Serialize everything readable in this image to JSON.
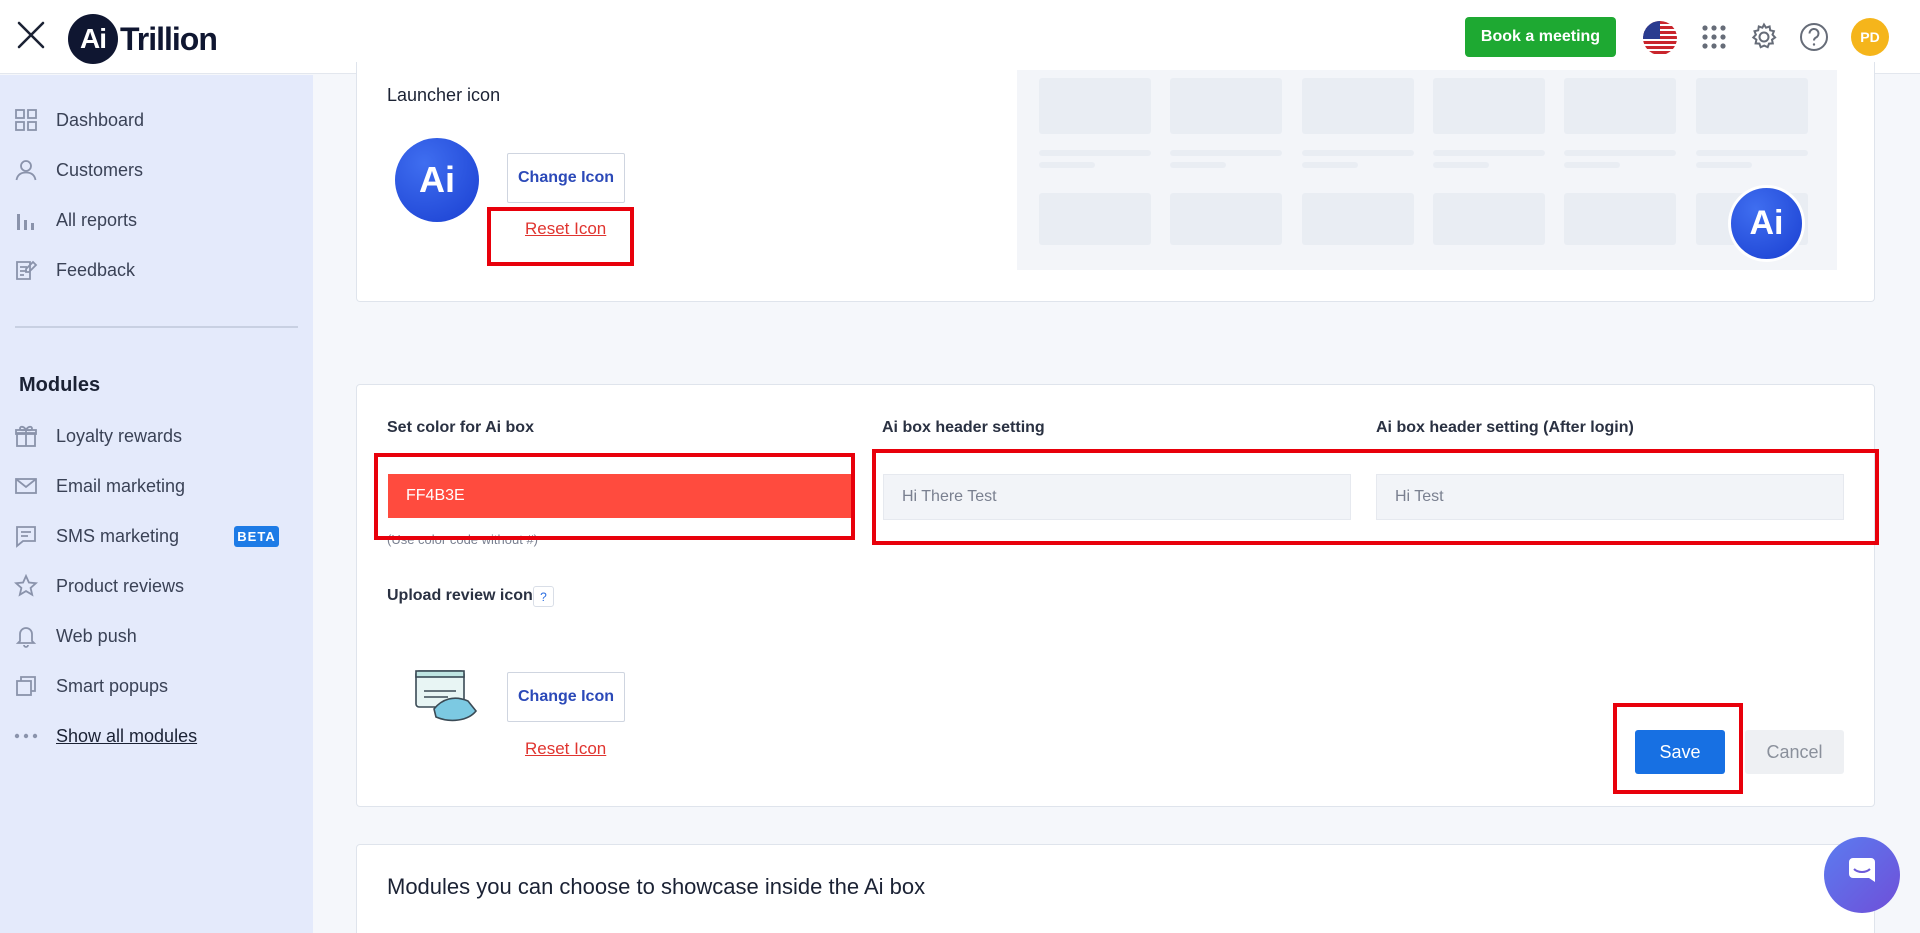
{
  "app": {
    "logo_mark": "Ai",
    "logo_text": "Trillion"
  },
  "header": {
    "book_meeting_label": "Book a meeting",
    "avatar_initials": "PD",
    "icons": [
      "close-icon",
      "us-flag-icon",
      "apps-grid-icon",
      "gear-icon",
      "help-icon"
    ]
  },
  "sidebar": {
    "items": [
      {
        "label": "Dashboard",
        "icon": "dashboard-icon"
      },
      {
        "label": "Customers",
        "icon": "user-icon"
      },
      {
        "label": "All reports",
        "icon": "bar-chart-icon"
      },
      {
        "label": "Feedback",
        "icon": "feedback-icon"
      }
    ],
    "modules_title": "Modules",
    "modules": [
      {
        "label": "Loyalty rewards",
        "icon": "gift-icon"
      },
      {
        "label": "Email marketing",
        "icon": "mail-icon"
      },
      {
        "label": "SMS marketing",
        "icon": "chat-icon",
        "badge": "BETA"
      },
      {
        "label": "Product reviews",
        "icon": "star-icon"
      },
      {
        "label": "Web push",
        "icon": "bell-icon"
      },
      {
        "label": "Smart popups",
        "icon": "popup-icon"
      },
      {
        "label": "Show all modules",
        "icon": "more-icon"
      }
    ]
  },
  "launcher": {
    "title": "Launcher icon",
    "icon_text": "Ai",
    "change_label": "Change Icon",
    "reset_label": "Reset Icon"
  },
  "aibox": {
    "color_label": "Set color for Ai box",
    "color_value": "FF4B3E",
    "color_hint": "(Use color code without #)",
    "header_label": "Ai box header setting",
    "header_placeholder": "Hi There Test",
    "header_after_label": "Ai box header setting (After login)",
    "header_after_placeholder": "Hi Test",
    "upload_label": "Upload review icon",
    "help_mark": "?",
    "change_label": "Change Icon",
    "reset_label": "Reset Icon",
    "save_label": "Save",
    "cancel_label": "Cancel"
  },
  "modules_section": {
    "title": "Modules you can choose to showcase inside the Ai box"
  },
  "colors": {
    "accent": "#1770e3",
    "brand_green": "#1ea932",
    "ai_color": "#FF4B3E",
    "highlight": "#e8000b"
  }
}
